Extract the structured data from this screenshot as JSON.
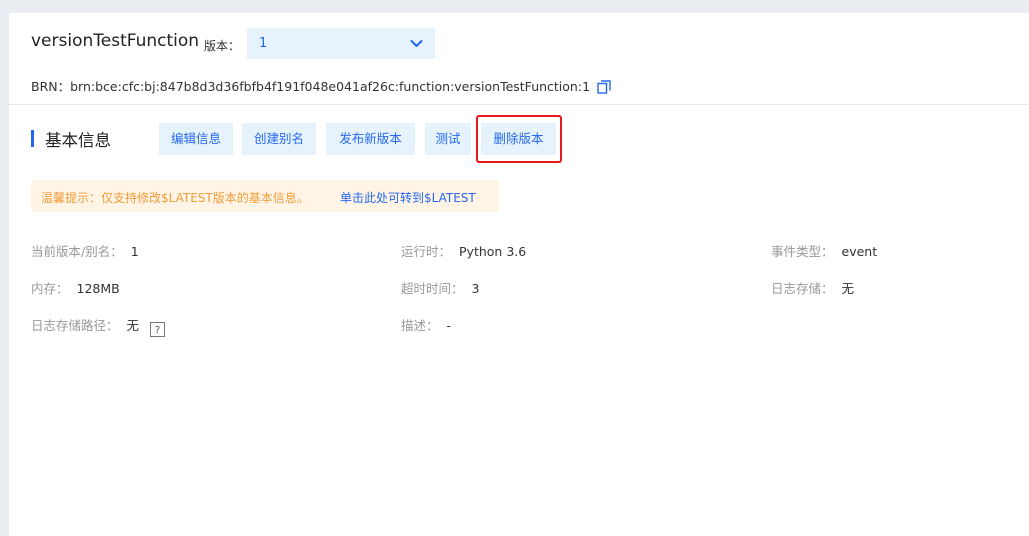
{
  "header": {
    "function_name": "versionTestFunction",
    "version_label": "版本：",
    "version_selected": "1",
    "brn_label": "BRN：",
    "brn_value": "brn:bce:cfc:bj:847b8d3d36fbfb4f191f048e041af26c:function:versionTestFunction:1"
  },
  "section": {
    "title": "基本信息"
  },
  "toolbar": {
    "edit_label": "编辑信息",
    "alias_label": "创建别名",
    "publish_label": "发布新版本",
    "test_label": "测试",
    "delete_label": "删除版本"
  },
  "tip": {
    "text": "温馨提示：仅支持修改$LATEST版本的基本信息。",
    "link": "单击此处可转到$LATEST"
  },
  "info": {
    "version_alias_label": "当前版本/别名：",
    "version_alias_value": "1",
    "runtime_label": "运行时：",
    "runtime_value": "Python 3.6",
    "event_type_label": "事件类型：",
    "event_type_value": "event",
    "memory_label": "内存：",
    "memory_value": "128MB",
    "timeout_label": "超时时间：",
    "timeout_value": "3",
    "log_storage_label": "日志存储：",
    "log_storage_value": "无",
    "log_path_label": "日志存储路径：",
    "log_path_value": "无",
    "help_glyph": "?",
    "description_label": "描述：",
    "description_value": "-"
  },
  "colors": {
    "accent": "#2468f2",
    "button_bg": "#e6f3fd",
    "tip_bg": "#fff4e6",
    "tip_text": "#f29d38",
    "highlight": "#e6191e"
  },
  "icons": {
    "dropdown": "chevron-down-icon",
    "copy": "copy-icon",
    "help": "help-icon"
  }
}
